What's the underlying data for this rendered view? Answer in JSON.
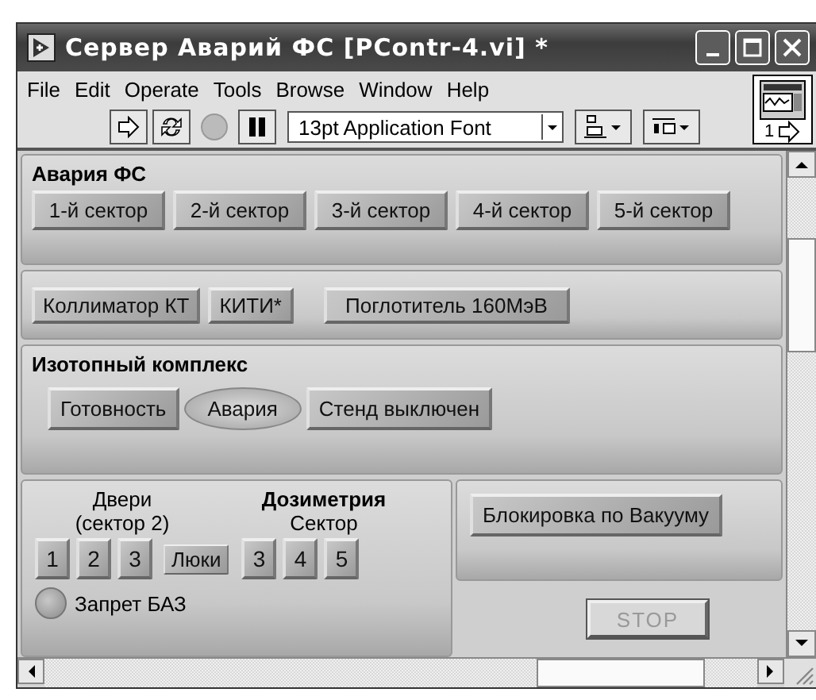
{
  "window": {
    "title": "Сервер Аварий ФС [PContr-4.vi] *"
  },
  "menu": [
    "File",
    "Edit",
    "Operate",
    "Tools",
    "Browse",
    "Window",
    "Help"
  ],
  "toolbar": {
    "font_select": "13pt Application Font",
    "abort_disabled": true
  },
  "vi_icon": {
    "label": "1"
  },
  "alarm_fs": {
    "title": "Авария ФС",
    "sectors": [
      "1-й сектор",
      "2-й сектор",
      "3-й сектор",
      "4-й сектор",
      "5-й сектор"
    ]
  },
  "devices": [
    "Коллиматор КТ",
    "КИТИ*",
    "Поглотитель 160МэВ"
  ],
  "isotope_complex": {
    "title": "Изотопный комплекс",
    "indicators": [
      {
        "label": "Готовность",
        "kind": "rect"
      },
      {
        "label": "Авария",
        "kind": "ellipse"
      },
      {
        "label": "Стенд выключен",
        "kind": "rect"
      }
    ]
  },
  "doors": {
    "title": "Двери",
    "subtitle": "(сектор 2)",
    "buttons": [
      "1",
      "2",
      "3"
    ],
    "hatches": "Люки"
  },
  "dosimetry": {
    "title": "Дозиметрия",
    "subtitle": "Сектор",
    "buttons": [
      "3",
      "4",
      "5"
    ]
  },
  "interlock": {
    "label": "Запрет БАЗ",
    "on": false
  },
  "vacuum_lock": "Блокировка по Вакууму",
  "stop_button": "STOP"
}
